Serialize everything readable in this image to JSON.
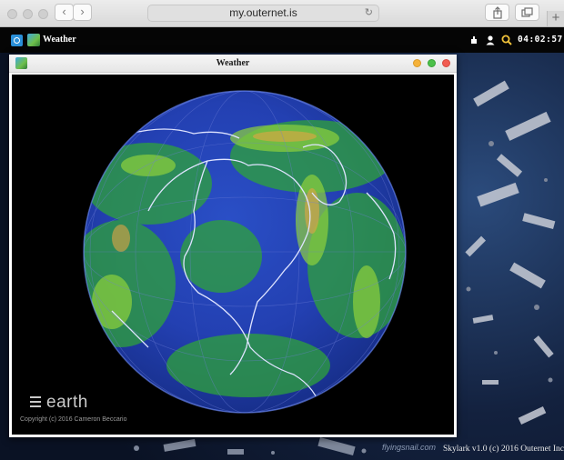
{
  "browser": {
    "url": "my.outernet.is",
    "back_glyph": "‹",
    "forward_glyph": "›",
    "reload_glyph": "↻",
    "share_icon": "share-icon",
    "tabs_icon": "tabs-icon",
    "new_tab_glyph": "+"
  },
  "skylark": {
    "app_title": "Weather",
    "clock": "04:02:57",
    "credit_site": "flyingsnail.com",
    "credit_version": "Skylark v1.0 (c) 2016 Outernet Inc"
  },
  "window": {
    "title": "Weather",
    "buttons": {
      "minimize_color": "#f5b23a",
      "zoom_color": "#4cc04a",
      "close_color": "#f15c52"
    }
  },
  "earth": {
    "logo": "earth",
    "copyright": "Copyright (c) 2016 Cameron Beccario"
  },
  "colors": {
    "accent": "#2a8fd8",
    "globe_ocean": "#1a3bb0",
    "globe_wind": "#3fbf3a"
  }
}
